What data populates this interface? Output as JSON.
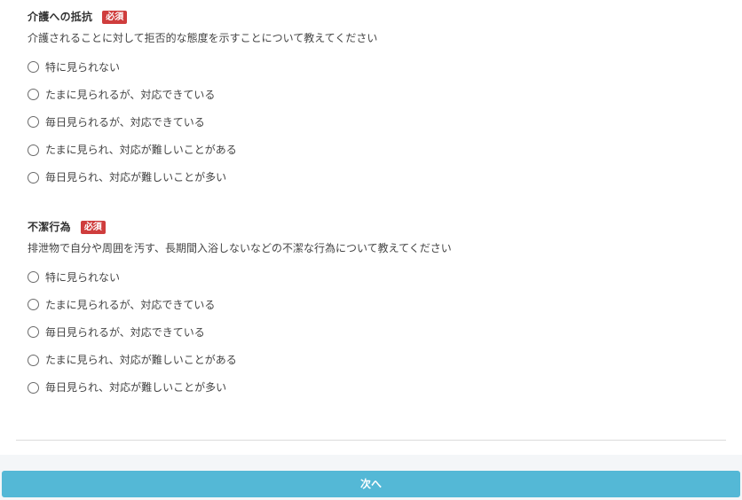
{
  "colors": {
    "required_badge": "#cf3d3d",
    "primary_button": "#54b8d6",
    "page_background": "#f4f6f8",
    "card_background": "#ffffff"
  },
  "questions": [
    {
      "title": "介護への抵抗",
      "required_label": "必須",
      "description": "介護されることに対して拒否的な態度を示すことについて教えてください",
      "options": [
        "特に見られない",
        "たまに見られるが、対応できている",
        "毎日見られるが、対応できている",
        "たまに見られ、対応が難しいことがある",
        "毎日見られ、対応が難しいことが多い"
      ]
    },
    {
      "title": "不潔行為",
      "required_label": "必須",
      "description": "排泄物で自分や周囲を汚す、長期間入浴しないなどの不潔な行為について教えてください",
      "options": [
        "特に見られない",
        "たまに見られるが、対応できている",
        "毎日見られるが、対応できている",
        "たまに見られ、対応が難しいことがある",
        "毎日見られ、対応が難しいことが多い"
      ]
    }
  ],
  "footer": {
    "next_label": "次へ"
  }
}
